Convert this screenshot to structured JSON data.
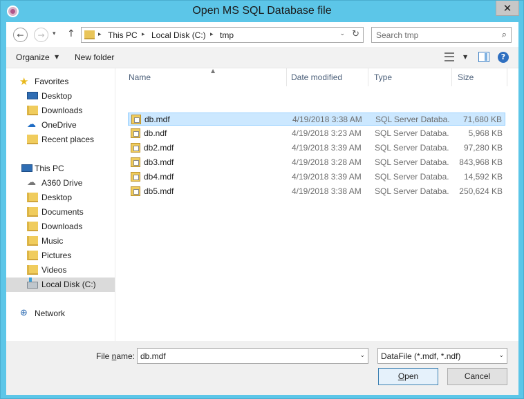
{
  "window": {
    "title": "Open MS SQL Database file",
    "close_glyph": "✕"
  },
  "address": {
    "crumbs": [
      "This PC",
      "Local Disk (C:)",
      "tmp"
    ],
    "sep_glyph": "▸",
    "dropdown_glyph": "⌄",
    "refresh_glyph": "↻"
  },
  "nav_buttons": {
    "back_glyph": "←",
    "forward_glyph": "→",
    "recent_glyph": "▾",
    "up_glyph": "↑"
  },
  "search": {
    "placeholder": "Search tmp",
    "value": "",
    "icon_glyph": "⌕"
  },
  "toolbar": {
    "organize_label": "Organize",
    "organize_caret": "▼",
    "new_folder_label": "New folder",
    "view_caret": "▼",
    "help_glyph": "?"
  },
  "navpane": {
    "favorites": {
      "label": "Favorites",
      "items": [
        "Desktop",
        "Downloads",
        "OneDrive",
        "Recent places"
      ]
    },
    "this_pc": {
      "label": "This PC",
      "items": [
        "A360 Drive",
        "Desktop",
        "Documents",
        "Downloads",
        "Music",
        "Pictures",
        "Videos",
        "Local Disk (C:)"
      ],
      "selected": "Local Disk (C:)"
    },
    "network": {
      "label": "Network"
    },
    "icons": {
      "star": "★",
      "onedrive": "☁",
      "cloud": "☁",
      "network": "⊕"
    }
  },
  "filelist": {
    "columns": {
      "name": "Name",
      "date": "Date modified",
      "type": "Type",
      "size": "Size"
    },
    "sort_glyph": "▲",
    "selected": "db.mdf",
    "rows": [
      {
        "name": "db.mdf",
        "date": "4/19/2018 3:38 AM",
        "type": "SQL Server Databa...",
        "size": "71,680 KB"
      },
      {
        "name": "db.ndf",
        "date": "4/19/2018 3:23 AM",
        "type": "SQL Server Databa...",
        "size": "5,968 KB"
      },
      {
        "name": "db2.mdf",
        "date": "4/19/2018 3:39 AM",
        "type": "SQL Server Databa...",
        "size": "97,280 KB"
      },
      {
        "name": "db3.mdf",
        "date": "4/19/2018 3:28 AM",
        "type": "SQL Server Databa...",
        "size": "843,968 KB"
      },
      {
        "name": "db4.mdf",
        "date": "4/19/2018 3:39 AM",
        "type": "SQL Server Databa...",
        "size": "14,592 KB"
      },
      {
        "name": "db5.mdf",
        "date": "4/19/2018 3:38 AM",
        "type": "SQL Server Databa...",
        "size": "250,624 KB"
      }
    ]
  },
  "bottom": {
    "file_name_label_pre": "File ",
    "file_name_label_key": "n",
    "file_name_label_post": "ame:",
    "file_name_value": "db.mdf",
    "combo_caret": "⌄",
    "filter_value": "DataFile (*.mdf, *.ndf)",
    "open_key": "O",
    "open_rest": "pen",
    "cancel_label": "Cancel"
  },
  "colors": {
    "frame": "#5cc6e8",
    "selection": "#cce8ff",
    "selection_border": "#99d1ff",
    "header_text": "#4c607a"
  }
}
